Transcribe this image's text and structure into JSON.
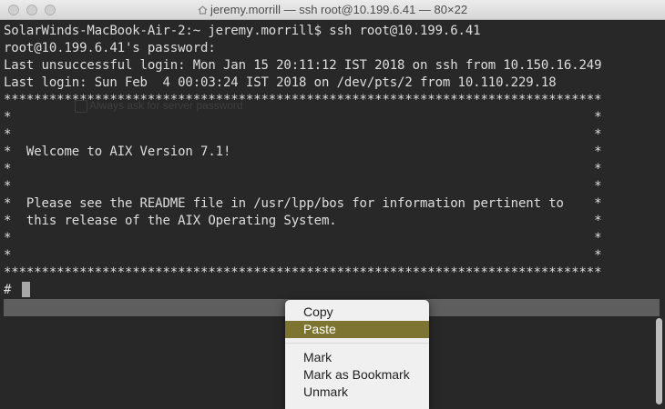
{
  "window": {
    "title": "jeremy.morrill — ssh root@10.199.6.41 — 80×22"
  },
  "terminal": {
    "lines": [
      "SolarWinds-MacBook-Air-2:~ jeremy.morrill$ ssh root@10.199.6.41",
      "root@10.199.6.41's password:",
      "Last unsuccessful login: Mon Jan 15 20:11:12 IST 2018 on ssh from 10.150.16.249",
      "Last login: Sun Feb  4 00:03:24 IST 2018 on /dev/pts/2 from 10.110.229.18",
      "*******************************************************************************",
      "*                                                                             *",
      "*                                                                             *",
      "*  Welcome to AIX Version 7.1!                                                *",
      "*                                                                             *",
      "*                                                                             *",
      "*  Please see the README file in /usr/lpp/bos for information pertinent to    *",
      "*  this release of the AIX Operating System.                                  *",
      "*                                                                             *",
      "*                                                                             *",
      "*******************************************************************************",
      "# "
    ],
    "ghost_text": {
      "checkbox_label": "Always ask for server password"
    }
  },
  "context_menu": {
    "items": [
      "Copy",
      "Paste",
      "Mark",
      "Mark as Bookmark",
      "Unmark"
    ],
    "highlighted": "Paste"
  },
  "colors": {
    "terminal_bg": "#282828",
    "terminal_fg": "#dedede",
    "menu_highlight": "#7d7431"
  }
}
